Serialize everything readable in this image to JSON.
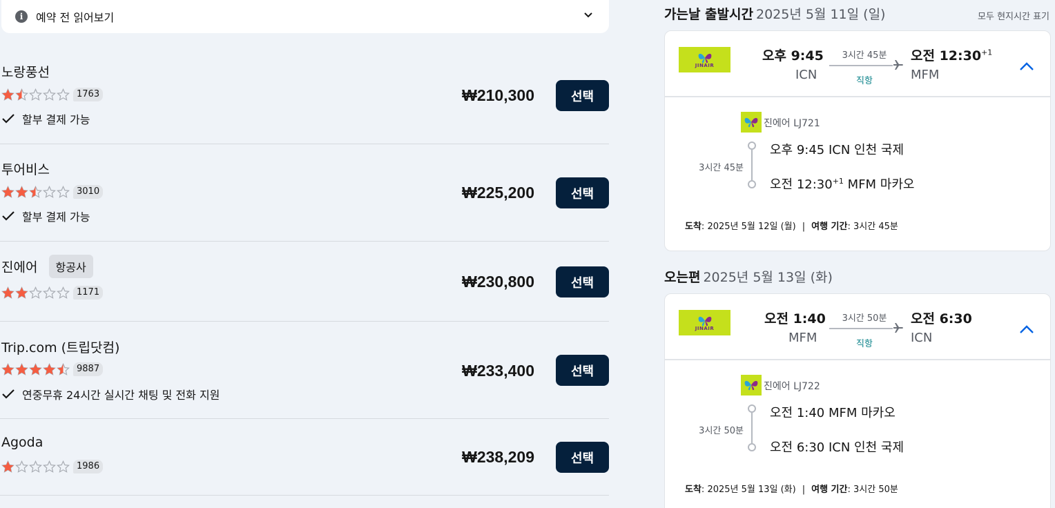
{
  "info_bar": {
    "label": "예약 전 읽어보기",
    "icon": "info-icon"
  },
  "providers": [
    {
      "name": "노랑풍선",
      "badge": "",
      "rating_stars": 1.5,
      "reviews": "1763",
      "feature": "할부 결제 가능",
      "price": "₩210,300",
      "button": "선택"
    },
    {
      "name": "투어비스",
      "badge": "",
      "rating_stars": 2.5,
      "reviews": "3010",
      "feature": "할부 결제 가능",
      "price": "₩225,200",
      "button": "선택"
    },
    {
      "name": "진에어",
      "badge": "항공사",
      "rating_stars": 2,
      "reviews": "1171",
      "feature": "",
      "price": "₩230,800",
      "button": "선택"
    },
    {
      "name": "Trip.com (트립닷컴)",
      "badge": "",
      "rating_stars": 4.5,
      "reviews": "9887",
      "feature": "연중무휴 24시간 실시간 채팅 및 전화 지원",
      "price": "₩233,400",
      "button": "선택"
    },
    {
      "name": "Agoda",
      "badge": "",
      "rating_stars": 1,
      "reviews": "1986",
      "feature": "",
      "price": "₩238,209",
      "button": "선택"
    }
  ],
  "outbound": {
    "title": "가는날 출발시간",
    "date": "2025년 5월 11일 (일)",
    "note": "모두 현지시간 표기",
    "airline_logo_text": "JINAIR",
    "dep_time": "오후 9:45",
    "dep_code": "ICN",
    "arr_time": "오전 12:30",
    "arr_day_offset": "+1",
    "arr_code": "MFM",
    "duration": "3시간 45분",
    "stops": "직항",
    "flight": "진에어 LJ721",
    "leg_dep": "오후 9:45 ICN 인천 국제",
    "leg_arr_time": "오전 12:30",
    "leg_arr_rest": " MFM 마카오",
    "arrival_label": "도착",
    "arrival_date": "2025년 5월 12일 (월)",
    "travel_label": "여행 기간",
    "travel_time": "3시간 45분"
  },
  "inbound": {
    "title": "오는편",
    "date": "2025년 5월 13일 (화)",
    "airline_logo_text": "JINAIR",
    "dep_time": "오전 1:40",
    "dep_code": "MFM",
    "arr_time": "오전 6:30",
    "arr_code": "ICN",
    "duration": "3시간 50분",
    "stops": "직항",
    "flight": "진에어 LJ722",
    "leg_dep": "오전 1:40 MFM 마카오",
    "leg_arr": "오전 6:30 ICN 인천 국제",
    "arrival_label": "도착",
    "arrival_date": "2025년 5월 13일 (화)",
    "travel_label": "여행 기간",
    "travel_time": "3시간 50분"
  },
  "colors": {
    "button": "#05203c",
    "star": "#f55d42",
    "direct": "#0c838a",
    "accent": "#0062e3",
    "logo_bg": "#c5e01c"
  }
}
